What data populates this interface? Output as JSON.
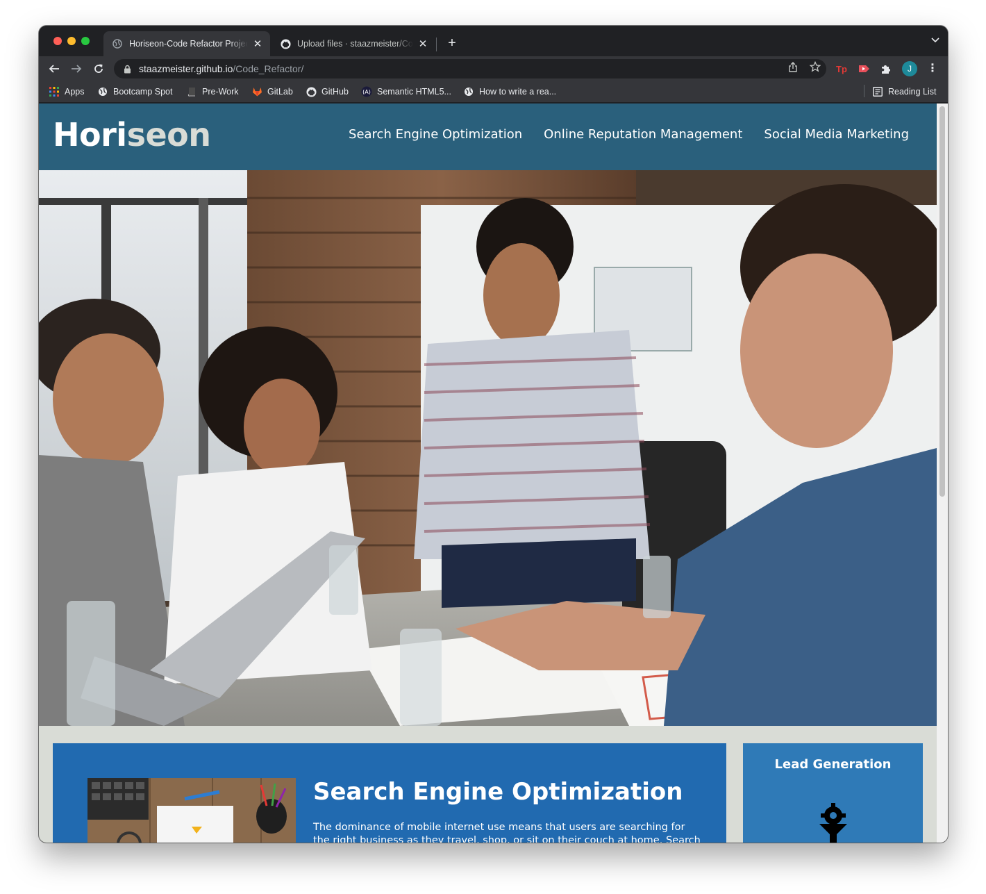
{
  "browser": {
    "tabs": [
      {
        "title": "Horiseon-Code Refactor Project",
        "active": true
      },
      {
        "title": "Upload files · staazmeister/Code_Refactor",
        "active": false
      }
    ],
    "address": {
      "host": "staazmeister.github.io",
      "path": "/Code_Refactor/"
    },
    "bookmarks": [
      "Apps",
      "Bootcamp Spot",
      "Pre-Work",
      "GitLab",
      "GitHub",
      "Semantic HTML5...",
      "How to write a rea..."
    ],
    "reading_list": "Reading List",
    "profile_initial": "J",
    "extensions": [
      "Tp"
    ]
  },
  "site": {
    "logo_main": "Hori",
    "logo_accent": "seon",
    "nav": [
      "Search Engine Optimization",
      "Online Reputation Management",
      "Social Media Marketing"
    ],
    "hero_alt": "",
    "section": {
      "title": "Search Engine Optimization",
      "text": "The dominance of mobile internet use means that users are searching for the right business as they travel, shop, or sit on their couch at home. Search Engine"
    },
    "aside": {
      "title": "Lead Generation"
    }
  },
  "colors": {
    "header": "#2a607c",
    "page_bg": "#d9dcd6",
    "section_bg": "#216ab0",
    "aside_bg": "#2f7ab7"
  }
}
